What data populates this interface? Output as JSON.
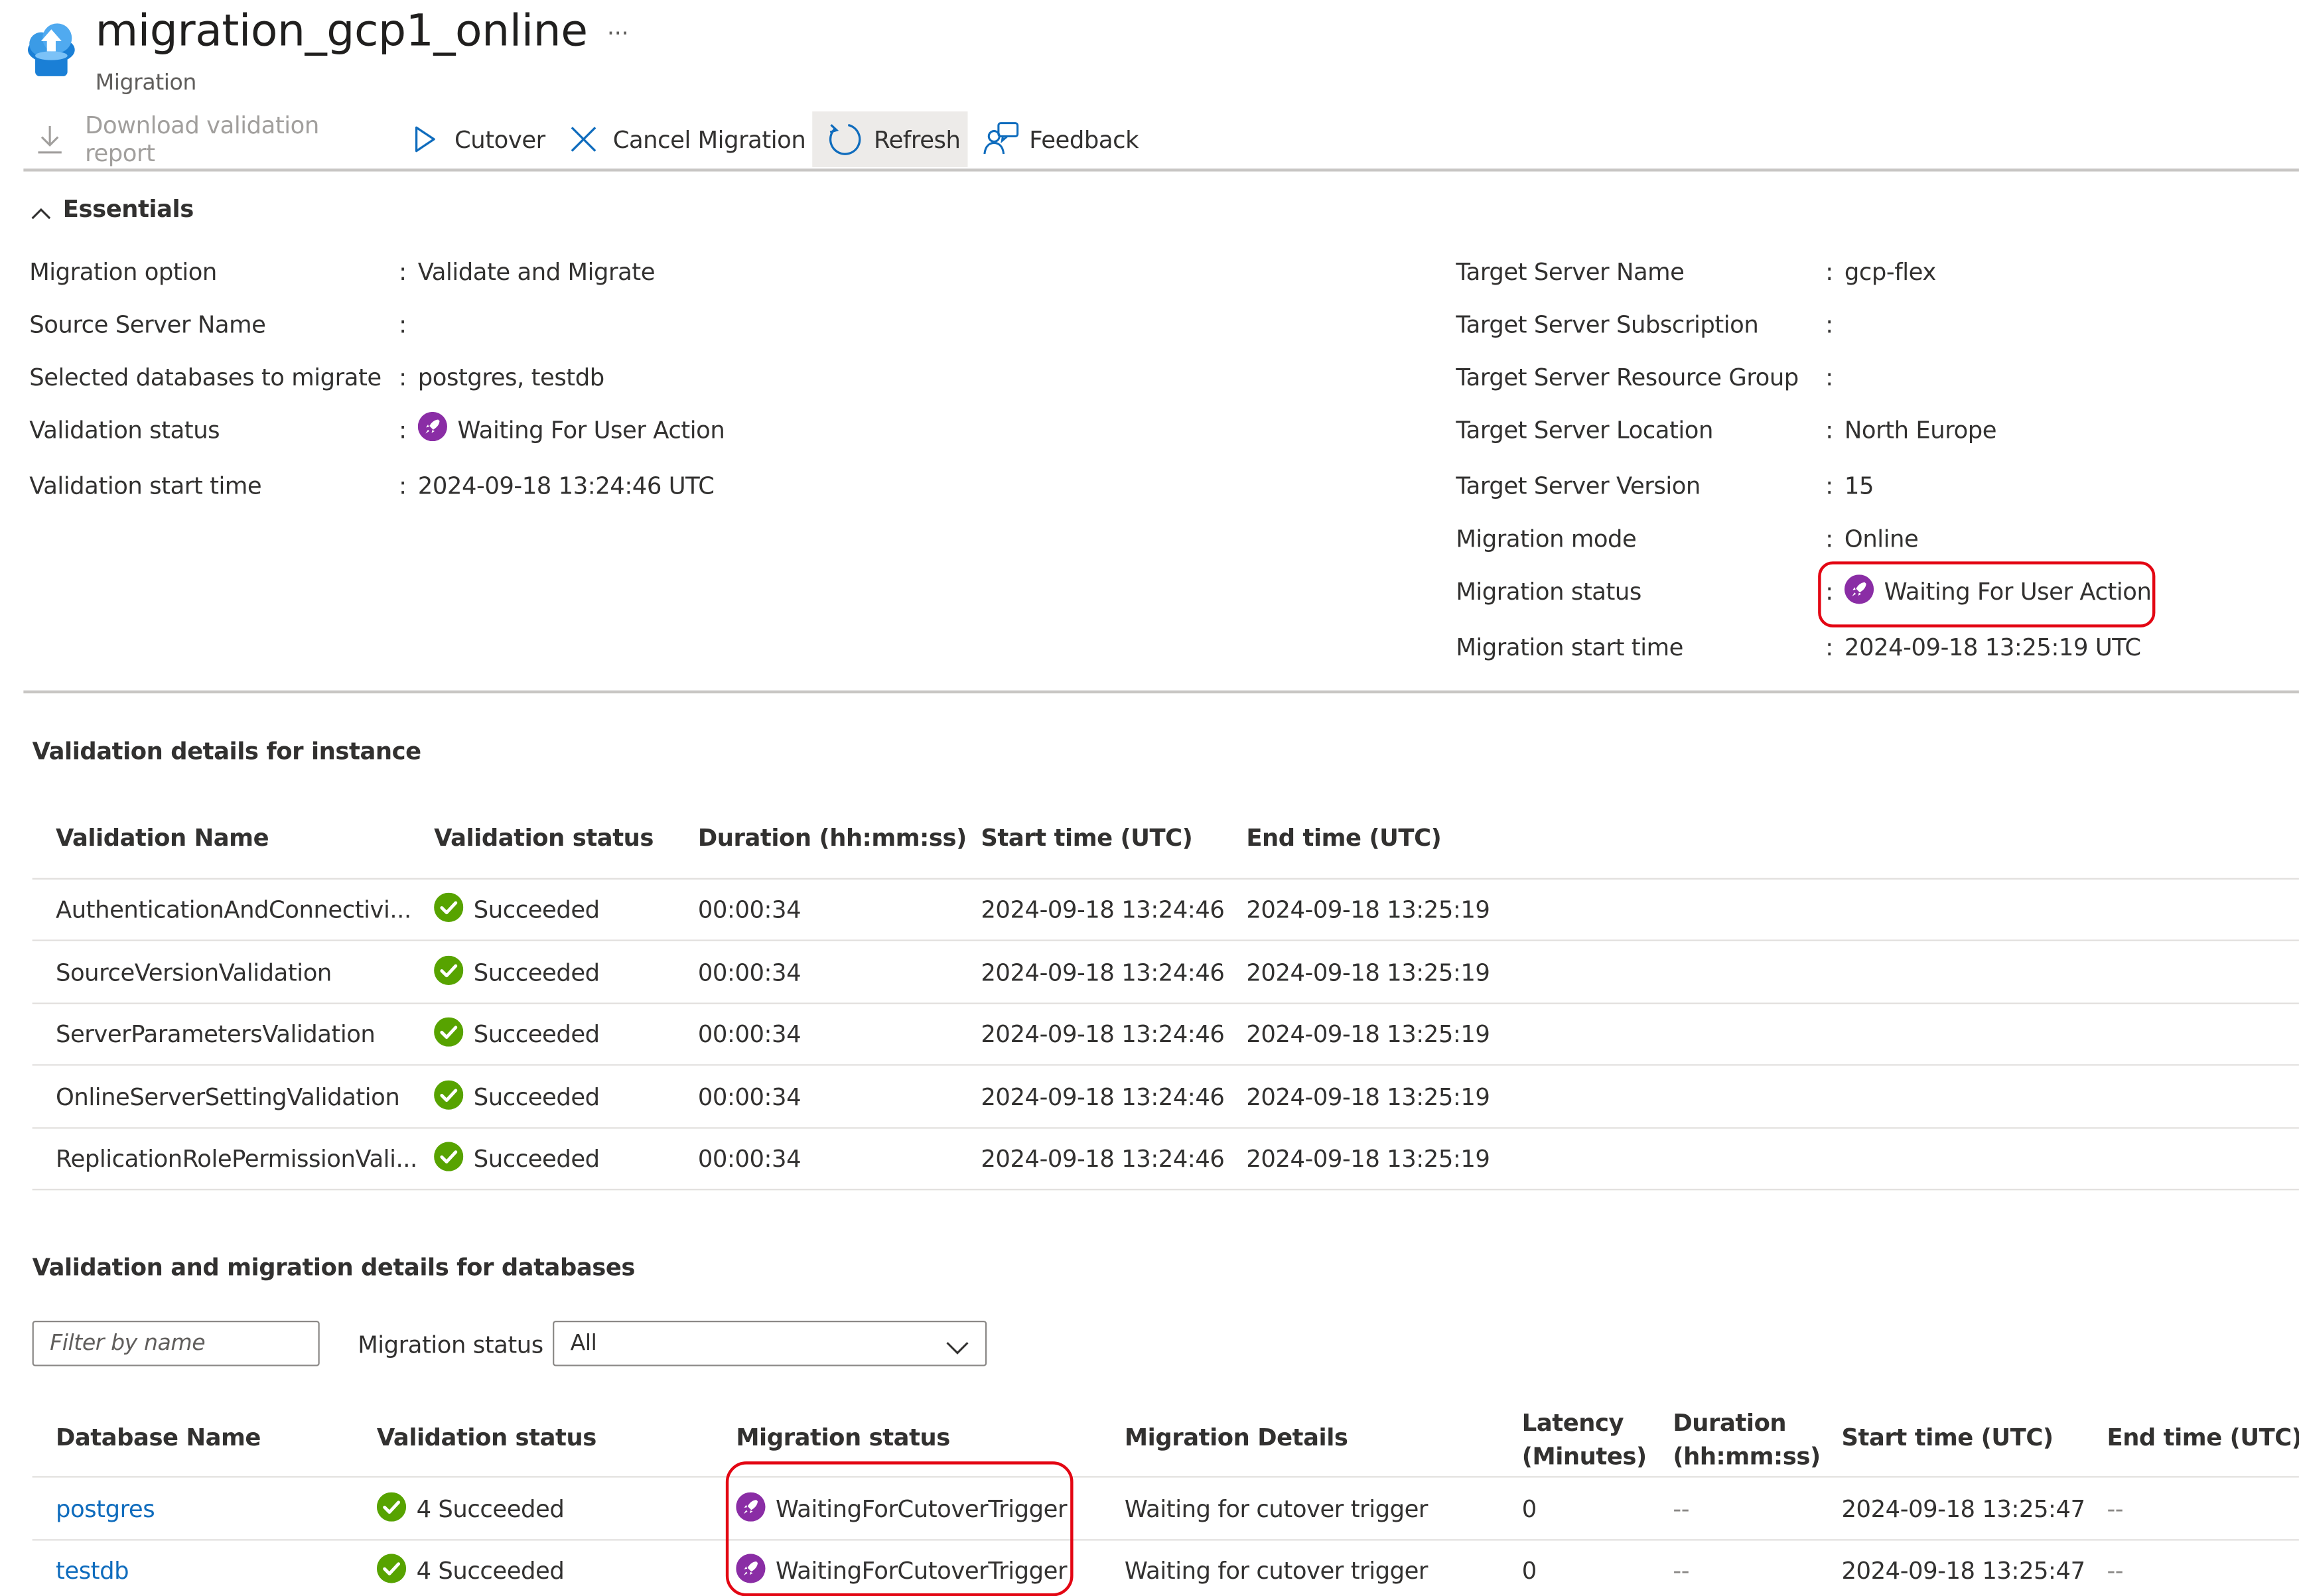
{
  "header": {
    "title": "migration_gcp1_online",
    "subtitle": "Migration",
    "more_label": "···"
  },
  "toolbar": {
    "download_label": "Download validation report",
    "cutover_label": "Cutover",
    "cancel_label": "Cancel Migration",
    "refresh_label": "Refresh",
    "feedback_label": "Feedback"
  },
  "essentials": {
    "toggle_label": "Essentials",
    "left": [
      {
        "label": "Migration option",
        "value": "Validate and Migrate"
      },
      {
        "label": "Source Server Name",
        "value": ""
      },
      {
        "label": "Selected databases to migrate",
        "value": "postgres, testdb"
      },
      {
        "label": "Validation status",
        "value": "Waiting For User Action"
      },
      {
        "label": "Validation start time",
        "value": "2024-09-18 13:24:46 UTC"
      }
    ],
    "right": [
      {
        "label": "Target Server Name",
        "value": "gcp-flex"
      },
      {
        "label": "Target Server Subscription",
        "value": ""
      },
      {
        "label": "Target Server Resource Group",
        "value": ""
      },
      {
        "label": "Target Server Location",
        "value": "North Europe"
      },
      {
        "label": "Target Server Version",
        "value": "15"
      },
      {
        "label": "Migration mode",
        "value": "Online"
      },
      {
        "label": "Migration status",
        "value": "Waiting For User Action"
      },
      {
        "label": "Migration start time",
        "value": "2024-09-18 13:25:19 UTC"
      }
    ]
  },
  "validation_instance": {
    "title": "Validation details for instance",
    "headers": [
      "Validation Name",
      "Validation status",
      "Duration (hh:mm:ss)",
      "Start time (UTC)",
      "End time (UTC)"
    ],
    "rows": [
      {
        "name": "AuthenticationAndConnectivi...",
        "status": "Succeeded",
        "duration": "00:00:34",
        "start": "2024-09-18 13:24:46",
        "end": "2024-09-18 13:25:19"
      },
      {
        "name": "SourceVersionValidation",
        "status": "Succeeded",
        "duration": "00:00:34",
        "start": "2024-09-18 13:24:46",
        "end": "2024-09-18 13:25:19"
      },
      {
        "name": "ServerParametersValidation",
        "status": "Succeeded",
        "duration": "00:00:34",
        "start": "2024-09-18 13:24:46",
        "end": "2024-09-18 13:25:19"
      },
      {
        "name": "OnlineServerSettingValidation",
        "status": "Succeeded",
        "duration": "00:00:34",
        "start": "2024-09-18 13:24:46",
        "end": "2024-09-18 13:25:19"
      },
      {
        "name": "ReplicationRolePermissionVali...",
        "status": "Succeeded",
        "duration": "00:00:34",
        "start": "2024-09-18 13:24:46",
        "end": "2024-09-18 13:25:19"
      }
    ]
  },
  "databases": {
    "title": "Validation and migration details for databases",
    "filter_placeholder": "Filter by name",
    "status_filter_label": "Migration status",
    "status_filter_value": "All",
    "headers": {
      "db_name": "Database Name",
      "validation": "Validation status",
      "migration": "Migration status",
      "details": "Migration Details",
      "latency_1": "Latency",
      "latency_2": "(Minutes)",
      "duration_1": "Duration",
      "duration_2": "(hh:mm:ss)",
      "start": "Start time (UTC)",
      "end": "End time (UTC)"
    },
    "rows": [
      {
        "name": "postgres",
        "validation": "4 Succeeded",
        "migration": "WaitingForCutoverTrigger",
        "details": "Waiting for cutover trigger",
        "latency": "0",
        "duration": "--",
        "start": "2024-09-18 13:25:47",
        "end": "--"
      },
      {
        "name": "testdb",
        "validation": "4 Succeeded",
        "migration": "WaitingForCutoverTrigger",
        "details": "Waiting for cutover trigger",
        "latency": "0",
        "duration": "--",
        "start": "2024-09-18 13:25:47",
        "end": "--"
      }
    ]
  },
  "colors": {
    "accent": "#0f6cbd",
    "success": "#57a300",
    "waiting": "#8a2da5",
    "highlight": "#e30613"
  }
}
